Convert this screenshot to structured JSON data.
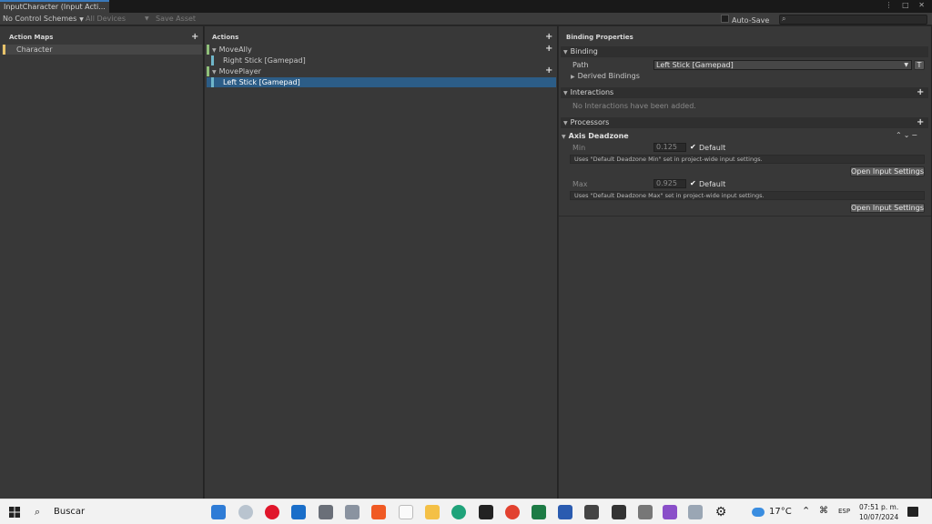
{
  "window": {
    "tab_title": "InputCharacter (Input Acti...",
    "controls": "⋮ □ ✕"
  },
  "toolbar": {
    "control_schemes": "No Control Schemes",
    "devices": "All Devices",
    "save_asset": "Save Asset",
    "auto_save": "Auto-Save",
    "search_placeholder": ""
  },
  "action_maps": {
    "header": "Action Maps",
    "items": [
      {
        "label": "Character",
        "color": "#e8c36a"
      }
    ]
  },
  "actions": {
    "header": "Actions",
    "items": [
      {
        "label": "MoveAlly",
        "bindings": [
          "Right Stick [Gamepad]"
        ]
      },
      {
        "label": "MovePlayer",
        "bindings": [
          "Left Stick [Gamepad]"
        ]
      }
    ],
    "action_color": "#8fbf7a",
    "binding_color": "#6fb6c9",
    "selected_color": "#2c5d87"
  },
  "properties": {
    "header": "Binding Properties",
    "binding_section": "Binding",
    "path_label": "Path",
    "path_value": "Left Stick [Gamepad]",
    "t_button": "T",
    "derived_bindings": "Derived Bindings",
    "interactions_section": "Interactions",
    "interactions_empty": "No Interactions have been added.",
    "processors_section": "Processors",
    "processor_name": "Axis Deadzone",
    "min_label": "Min",
    "min_value": "0.125",
    "max_label": "Max",
    "max_value": "0.925",
    "default_label": "Default",
    "min_note": "Uses \"Default Deadzone Min\" set in project-wide input settings.",
    "max_note": "Uses \"Default Deadzone Max\" set in project-wide input settings.",
    "open_settings": "Open Input Settings"
  },
  "taskbar": {
    "search_label": "Buscar",
    "weather": "17°C",
    "language": "ESP",
    "time": "07:51 p. m.",
    "date": "10/07/2024",
    "apps": [
      "mail-icon",
      "settings-app-icon",
      "opera-icon",
      "store-icon",
      "media-icon",
      "gift-icon",
      "brave-icon",
      "file-icon",
      "folder-icon",
      "edge-icon",
      "unity-icon",
      "chrome-icon",
      "excel-icon",
      "word-icon",
      "unity-hub-icon",
      "terminal-icon",
      "cube-icon",
      "visual-studio-icon",
      "photos-icon",
      "gear-icon"
    ]
  }
}
